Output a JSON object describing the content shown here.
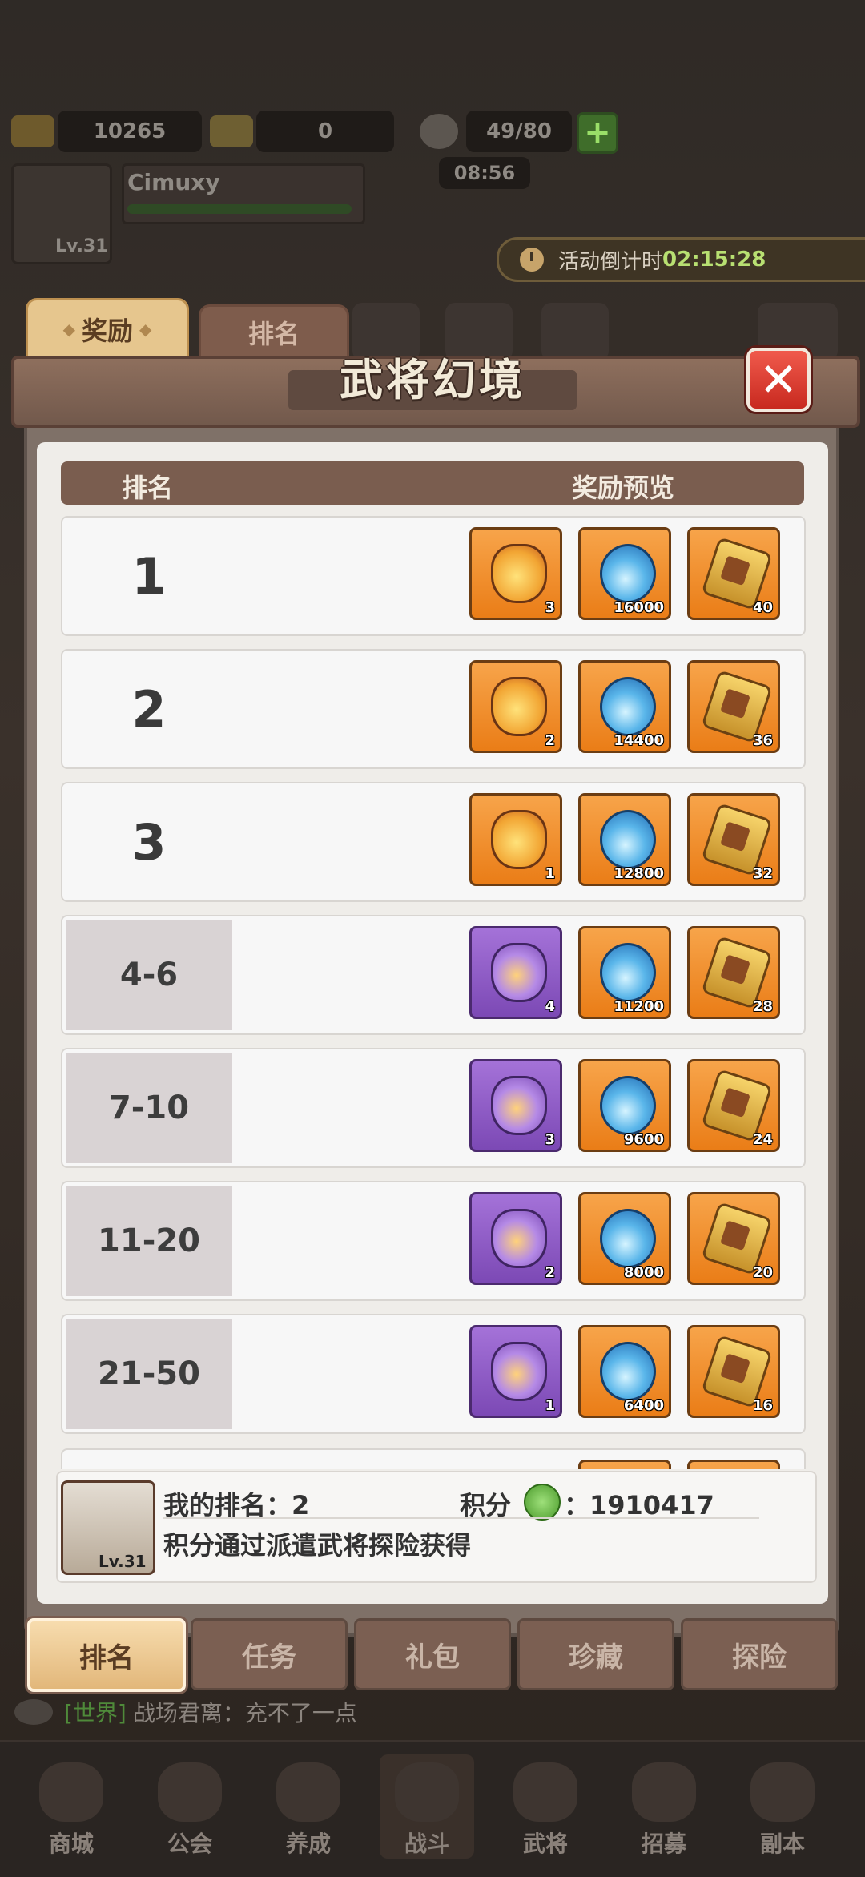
{
  "resources": {
    "gold": "10265",
    "tickets": "0",
    "stamina": "49/80",
    "stamina_timer": "08:56"
  },
  "player": {
    "name": "Cimuxy",
    "level": "Lv.31"
  },
  "event_timer": {
    "label": "活动倒计时",
    "value": "02:15:28"
  },
  "top_tabs": {
    "reward": "奖励",
    "ranking": "排名"
  },
  "panel": {
    "title": "武将幻境",
    "col_rank": "排名",
    "col_reward": "奖励预览"
  },
  "rows": [
    {
      "rank": "1",
      "bag": "3",
      "flame": "16000",
      "token": "40",
      "bag_color": "orange"
    },
    {
      "rank": "2",
      "bag": "2",
      "flame": "14400",
      "token": "36",
      "bag_color": "orange"
    },
    {
      "rank": "3",
      "bag": "1",
      "flame": "12800",
      "token": "32",
      "bag_color": "orange"
    },
    {
      "rank": "4-6",
      "bag": "4",
      "flame": "11200",
      "token": "28",
      "bag_color": "purple"
    },
    {
      "rank": "7-10",
      "bag": "3",
      "flame": "9600",
      "token": "24",
      "bag_color": "purple"
    },
    {
      "rank": "11-20",
      "bag": "2",
      "flame": "8000",
      "token": "20",
      "bag_color": "purple"
    },
    {
      "rank": "21-50",
      "bag": "1",
      "flame": "6400",
      "token": "16",
      "bag_color": "purple"
    }
  ],
  "my_rank": {
    "label": "我的排名：2",
    "score_label": "积分",
    "score_value": "：1910417",
    "hint": "积分通过派遣武将探险获得",
    "level": "Lv.31"
  },
  "bottom_tabs": [
    "排名",
    "任务",
    "礼包",
    "珍藏",
    "探险"
  ],
  "chat": {
    "channel": "[世界]",
    "message": "战场君离：充不了一点"
  },
  "nav": [
    "商城",
    "公会",
    "养成",
    "战斗",
    "武将",
    "招募",
    "副本"
  ],
  "colors": {
    "accent_orange": "#ea7d17",
    "accent_purple": "#7c49b5",
    "close_red": "#d8322a"
  }
}
